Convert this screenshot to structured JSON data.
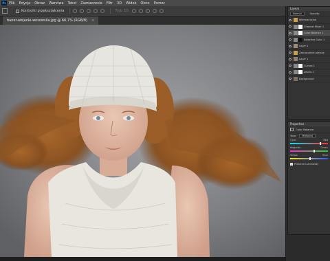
{
  "app": {
    "logo_text": "Ps"
  },
  "menu": [
    "Plik",
    "Edycja",
    "Obraz",
    "Warstwa",
    "Tekst",
    "Zaznaczenie",
    "Filtr",
    "3D",
    "Widok",
    "Okno",
    "Pomoc"
  ],
  "options_bar": {
    "checkbox_label": "Kontrolki przekształcenia",
    "mode_label": "Tryb 3D:"
  },
  "document": {
    "tab_title": "baner-wejanie-wosowslla.jpg @ 66,7% (RGB/8)",
    "close_glyph": "×"
  },
  "layers_panel": {
    "tab_label": "Layers",
    "blend_mode": "Normal",
    "opacity_label": "Opacity:",
    "layers": [
      {
        "name": "Wiersze dolne"
      },
      {
        "name": "Channel Mixer 1"
      },
      {
        "name": "Color Balance 1"
      },
      {
        "name": "Selective Color 1"
      },
      {
        "name": "Layer 2"
      },
      {
        "name": "Zaznaczenie piersze"
      },
      {
        "name": "Layer 1"
      },
      {
        "name": "Curves 1"
      },
      {
        "name": "Levels 1"
      },
      {
        "name": "Background"
      }
    ],
    "selected_index": 2
  },
  "properties_panel": {
    "tab_label": "Properties",
    "title": "Color Balance",
    "tone_label": "Tone:",
    "tone_value": "Midtones",
    "sliders": [
      {
        "left": "Cyan",
        "right": "Red",
        "value": 0.78
      },
      {
        "left": "Magenta",
        "right": "Green",
        "value": 0.62
      },
      {
        "left": "Yellow",
        "right": "Blue",
        "value": 0.5
      }
    ],
    "preserve_label": "Preserve Luminosity"
  },
  "colors": {
    "ui_dark": "#262626",
    "panel": "#333333",
    "accent": "#31a8ff"
  }
}
